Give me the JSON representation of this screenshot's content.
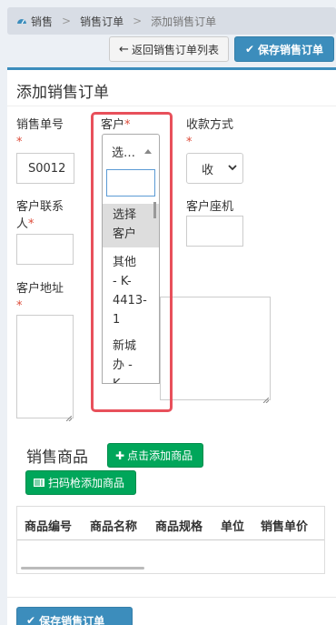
{
  "breadcrumb": {
    "home": "销售",
    "level2": "销售订单",
    "current": "添加销售订单",
    "separator": ">"
  },
  "toolbar": {
    "back_label": "返回销售订单列表",
    "save_label": "保存销售订单"
  },
  "form": {
    "title": "添加销售订单",
    "order_no": {
      "label": "销售单号",
      "required_mark": "*",
      "value": "S0012"
    },
    "customer": {
      "label": "客户",
      "required_mark": "*",
      "selected_text": "选…",
      "options": [
        {
          "lines": [
            "选择",
            "客户"
          ],
          "selected": true
        },
        {
          "lines": [
            "其他",
            "- K-",
            "4413-",
            "1"
          ],
          "selected": false
        },
        {
          "lines": [
            "新城",
            "办 -",
            "K"
          ],
          "selected": false
        }
      ]
    },
    "payment": {
      "label": "收款方式",
      "required_mark": "*",
      "value": "收"
    },
    "contact": {
      "label_line1": "客户联系",
      "label_line2": "人",
      "required_mark": "*",
      "value": ""
    },
    "landline": {
      "label": "客户座机",
      "value": ""
    },
    "address": {
      "label": "客户地址",
      "required_mark": "*",
      "value": ""
    }
  },
  "products": {
    "title": "销售商品",
    "add_button": "点击添加商品",
    "scan_button": "扫码枪添加商品",
    "columns": [
      "商品编号",
      "商品名称",
      "商品规格",
      "单位",
      "销售单价"
    ]
  },
  "footer": {
    "save_label": "保存销售订单"
  },
  "colors": {
    "primary": "#3c8dbc",
    "success": "#00a65a",
    "required": "#dd4b39",
    "highlight": "#e8505b"
  }
}
